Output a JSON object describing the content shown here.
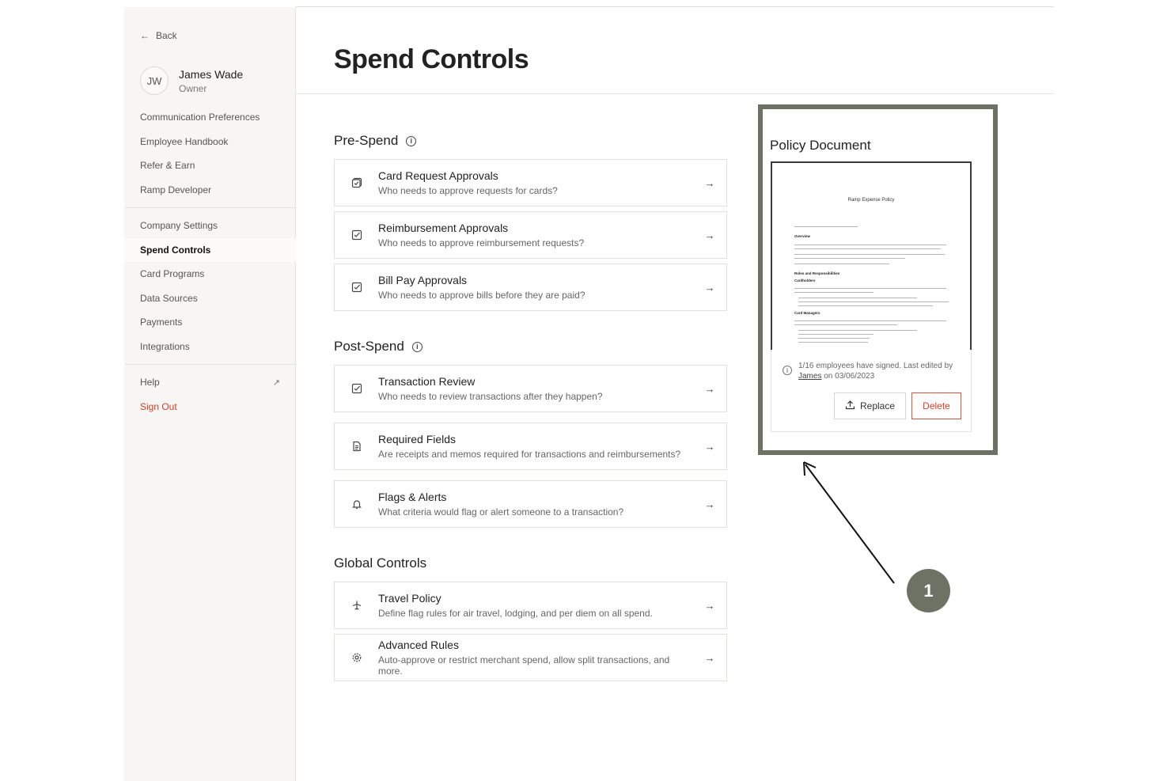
{
  "sidebar": {
    "back_label": "Back",
    "user": {
      "initials": "JW",
      "name": "James Wade",
      "role": "Owner"
    },
    "group1": [
      {
        "label": "Communication Preferences"
      },
      {
        "label": "Employee Handbook"
      },
      {
        "label": "Refer & Earn"
      },
      {
        "label": "Ramp Developer"
      }
    ],
    "group2": [
      {
        "label": "Company Settings"
      },
      {
        "label": "Spend Controls",
        "active": true
      },
      {
        "label": "Card Programs"
      },
      {
        "label": "Data Sources"
      },
      {
        "label": "Payments"
      },
      {
        "label": "Integrations"
      }
    ],
    "help_label": "Help",
    "signout_label": "Sign Out"
  },
  "page": {
    "title": "Spend Controls"
  },
  "sections": {
    "pre_spend": {
      "title": "Pre-Spend",
      "items": [
        {
          "title": "Card Request Approvals",
          "desc": "Who needs to approve requests for cards?",
          "icon": "card-check-icon"
        },
        {
          "title": "Reimbursement Approvals",
          "desc": "Who needs to approve reimbursement requests?",
          "icon": "checkbox-icon"
        },
        {
          "title": "Bill Pay Approvals",
          "desc": "Who needs to approve bills before they are paid?",
          "icon": "checkbox-icon"
        }
      ]
    },
    "post_spend": {
      "title": "Post-Spend",
      "items": [
        {
          "title": "Transaction Review",
          "desc": "Who needs to review transactions after they happen?",
          "icon": "checkbox-icon"
        },
        {
          "title": "Required Fields",
          "desc": "Are receipts and memos required for transactions and reimbursements?",
          "icon": "document-icon"
        },
        {
          "title": "Flags & Alerts",
          "desc": "What criteria would flag or alert someone to a transaction?",
          "icon": "bell-icon"
        }
      ]
    },
    "global": {
      "title": "Global Controls",
      "items": [
        {
          "title": "Travel Policy",
          "desc": "Define flag rules for air travel, lodging, and per diem on all spend.",
          "icon": "plane-icon"
        },
        {
          "title": "Advanced Rules",
          "desc": "Auto-approve or restrict merchant spend, allow split transactions, and more.",
          "icon": "gear-icon"
        }
      ]
    }
  },
  "policy": {
    "title": "Policy Document",
    "doc_heading": "Ramp Expense Policy",
    "doc_sections": [
      "Overview",
      "Roles and Responsibilities",
      "Cardholders",
      "Card Managers"
    ],
    "sign_status_prefix": "1/16 employees have signed. Last edited by",
    "sign_editor": "James",
    "sign_date_text": "on 03/06/2023",
    "replace_label": "Replace",
    "delete_label": "Delete"
  },
  "annotation": {
    "badge": "1",
    "color": "#6e7265"
  }
}
